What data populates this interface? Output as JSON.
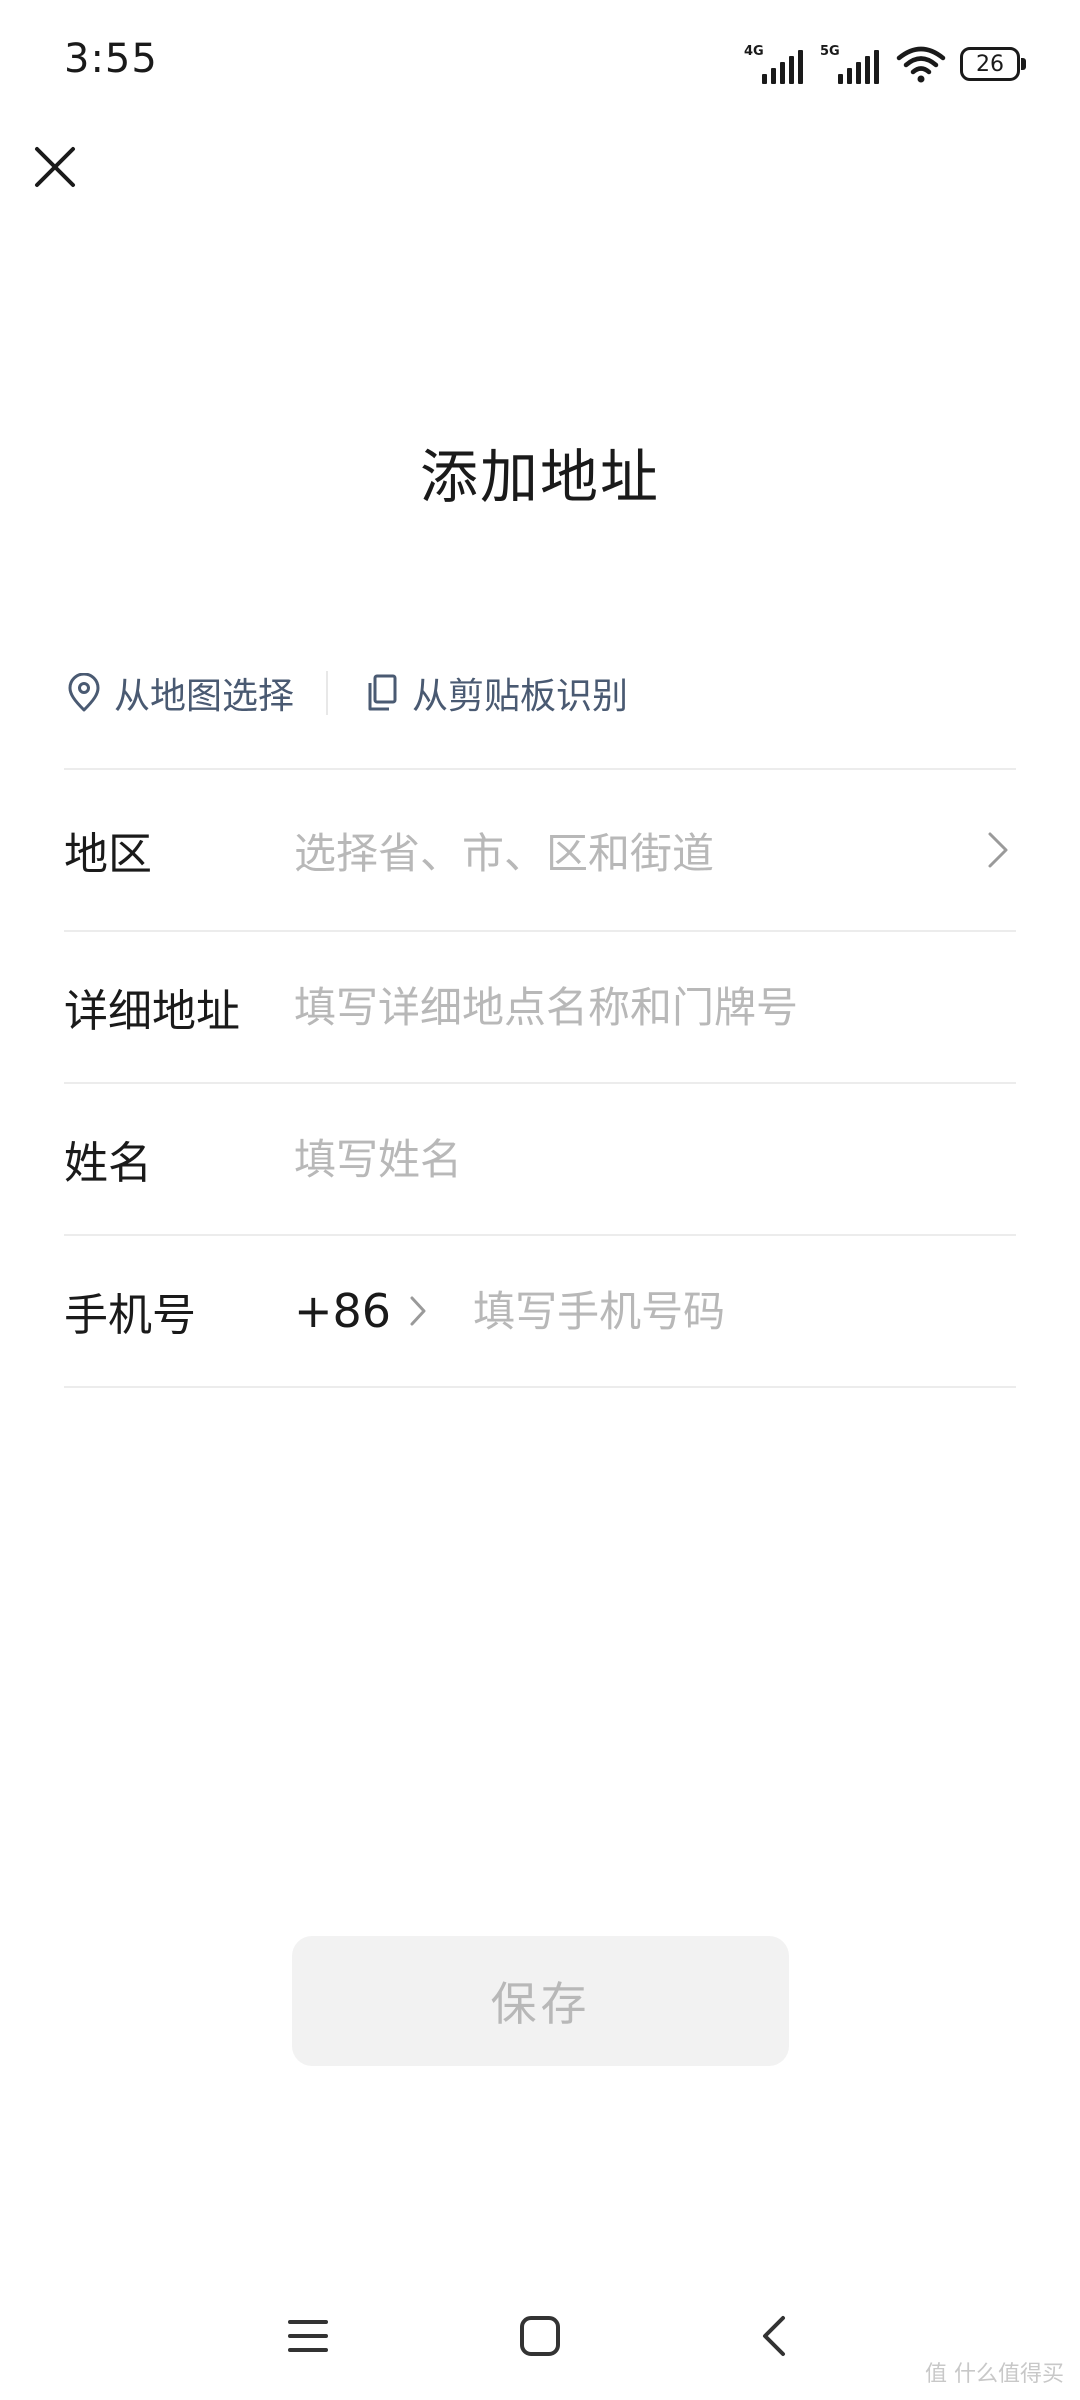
{
  "status_bar": {
    "time": "3:55",
    "signal1_type": "4G",
    "signal2_type": "5G",
    "battery": "26",
    "icons": [
      "signal-4g-icon",
      "signal-5g-icon",
      "wifi-icon",
      "battery-icon"
    ]
  },
  "header": {
    "close_icon": "close-icon",
    "title": "添加地址"
  },
  "quick_actions": [
    {
      "label": "从地图选择",
      "icon": "location-pin-icon"
    },
    {
      "label": "从剪贴板识别",
      "icon": "clipboard-icon"
    }
  ],
  "form": {
    "region": {
      "label": "地区",
      "placeholder": "选择省、市、区和街道",
      "icon": "chevron-right-icon"
    },
    "address": {
      "label": "详细地址",
      "placeholder": "填写详细地点名称和门牌号"
    },
    "name": {
      "label": "姓名",
      "placeholder": "填写姓名"
    },
    "phone": {
      "label": "手机号",
      "country_code": "+86",
      "placeholder": "填写手机号码"
    }
  },
  "save_button": {
    "label": "保存",
    "state": "disabled"
  },
  "nav_bar": {
    "icons": [
      "menu-icon",
      "home-icon",
      "back-icon"
    ]
  },
  "watermark": "值 什么值得买",
  "colors": {
    "text": "#1a1a1a",
    "placeholder": "#b8b8b8",
    "quick_action": "#4a5a72",
    "divider": "#ececec",
    "button_bg": "#f2f2f2"
  }
}
